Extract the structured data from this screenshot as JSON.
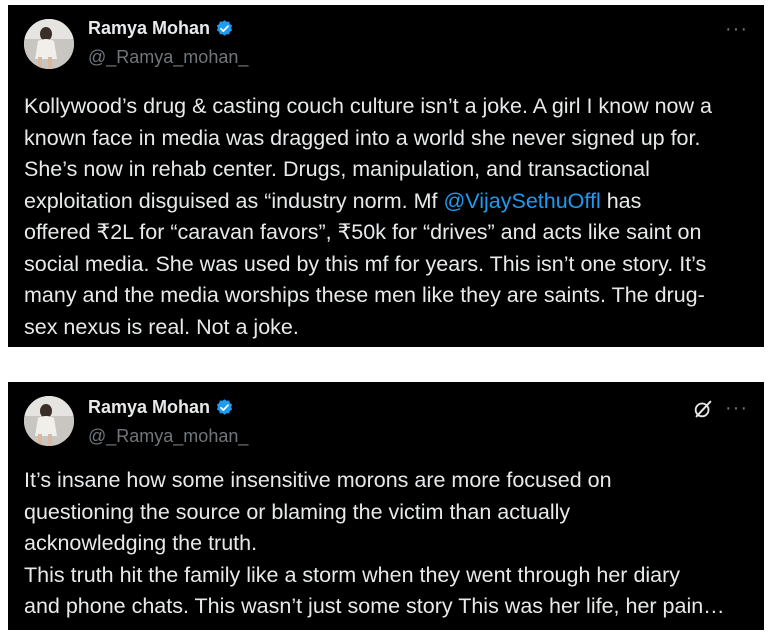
{
  "tweets": [
    {
      "author": {
        "name": "Ramya Mohan",
        "handle": "@_Ramya_mohan_"
      },
      "more_label": "···",
      "lines": [
        {
          "text": "Kollywood’s drug & casting couch culture isn’t a joke. A girl I know now a"
        },
        {
          "text": "known face in media was dragged into a world she never signed up for."
        },
        {
          "text": "She’s now in  rehab center. Drugs, manipulation, and transactional"
        },
        {
          "pre": "exploitation disguised as “industry norm. Mf ",
          "mention": "@VijaySethuOffl",
          "post": " has"
        },
        {
          "text": "offered ₹2L for “caravan favors”, ₹50k for “drives” and acts like saint on"
        },
        {
          "text": "social media. She was used by this mf for years. This isn’t one story. It’s"
        },
        {
          "text": "many and the media worships these men like they are saints. The drug-"
        },
        {
          "text": "sex nexus is real. Not a joke."
        }
      ]
    },
    {
      "author": {
        "name": "Ramya Mohan",
        "handle": "@_Ramya_mohan_"
      },
      "more_label": "···",
      "lines": [
        {
          "text": "It’s insane how some insensitive morons are more focused on"
        },
        {
          "text": "questioning the source or blaming the victim than actually"
        },
        {
          "text": "acknowledging the truth."
        },
        {
          "text": "This truth hit the family like a storm when they went through her diary"
        },
        {
          "text": "and phone chats. This wasn’t just some story This was her life, her pain…"
        }
      ]
    }
  ],
  "colors": {
    "background": "#000000",
    "text": "#e7e9ea",
    "secondary_text": "#71767b",
    "mention": "#1d9bf0",
    "verified_badge": "#1d9bf0"
  },
  "icons": {
    "verified": "verified-badge-icon",
    "more": "more-options-icon",
    "grok": "grok-icon"
  }
}
